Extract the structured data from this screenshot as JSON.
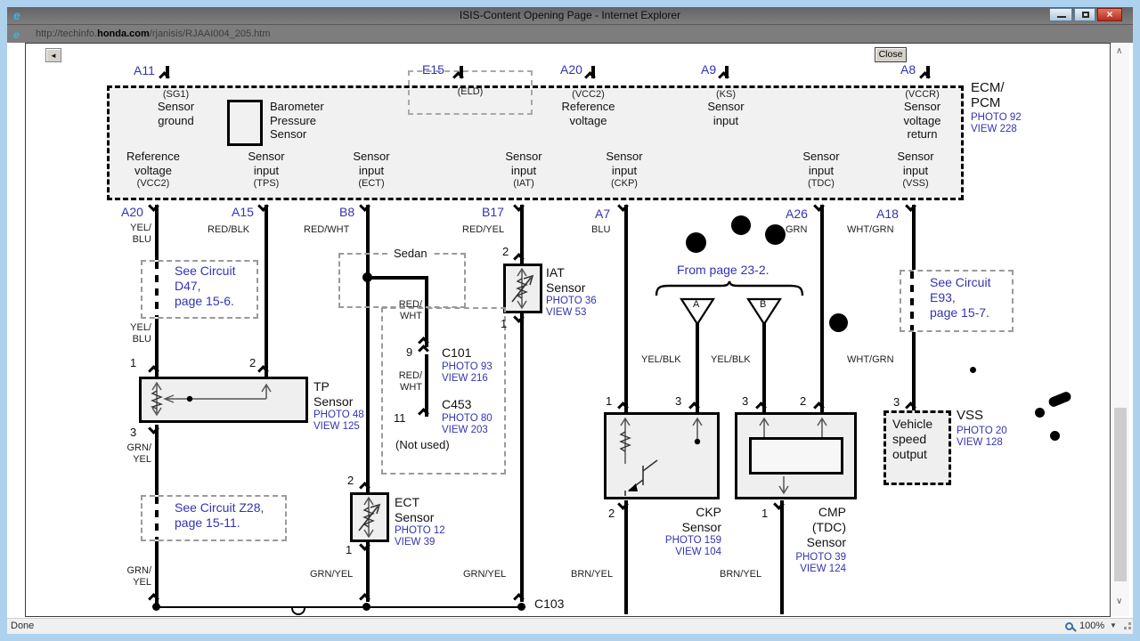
{
  "chrome": {
    "title": "ISIS-Content Opening Page - Internet Explorer",
    "url_prefix": "http://techinfo.",
    "url_domain": "honda.com",
    "url_suffix": "/rjanisis/RJAAI004_205.htm",
    "close_button": "Close",
    "status": "Done",
    "zoom_level": "100%",
    "icons": {
      "ie_logo": "e",
      "back": "◄",
      "scroll_up": "∧",
      "scroll_down": "∨",
      "zoom_dropdown": "▼",
      "window_close": "×"
    }
  },
  "colors": {
    "accent_blue": "#3333b3",
    "wire_black": "#000000",
    "box_fill": "#efefef"
  },
  "ecm": {
    "top_pins": [
      "A11",
      "E15",
      "A20",
      "A9",
      "A8"
    ],
    "sg1_tag": "(SG1)",
    "sg1_name": "Sensor\nground",
    "baro_name": "Barometer\nPressure\nSensor",
    "eld_tag": "(ELD)",
    "vcc2_tag": "(VCC2)",
    "vcc2_name": "Reference\nvoltage",
    "ks_tag": "(KS)",
    "ks_name": "Sensor\ninput",
    "vccr_tag": "(VCCR)",
    "vccr_name": "Sensor\nvoltage\nreturn",
    "row": [
      {
        "name": "Reference\nvoltage",
        "tag": "(VCC2)"
      },
      {
        "name": "Sensor\ninput",
        "tag": "(TPS)"
      },
      {
        "name": "Sensor\ninput",
        "tag": "(ECT)"
      },
      {
        "name": "Sensor\ninput",
        "tag": "(IAT)"
      },
      {
        "name": "Sensor\ninput",
        "tag": "(CKP)"
      },
      {
        "name": "Sensor\ninput",
        "tag": "(TDC)"
      },
      {
        "name": "Sensor\ninput",
        "tag": "(VSS)"
      }
    ],
    "unit_name": "ECM/\nPCM",
    "photo": "PHOTO 92",
    "view": "VIEW 228"
  },
  "pins": [
    "A20",
    "A15",
    "B8",
    "B17",
    "A7",
    "A26",
    "A18"
  ],
  "wire_labels": {
    "a20": "YEL/\nBLU",
    "a20_2": "YEL/\nBLU",
    "a15": "RED/BLK",
    "b8": "RED/WHT",
    "b17": "RED/YEL",
    "a7": "BLU",
    "a26": "GRN",
    "a18": "WHT/GRN",
    "a18_2": "WHT/GRN",
    "branch_1": "RED/\nWHT",
    "branch_2": "RED/\nWHT",
    "tp_out": "GRN/\nYEL",
    "tp_out_2": "GRN/\nYEL",
    "ect_out": "GRN/YEL",
    "iat_out": "GRN/YEL",
    "ckp_out": "BRN/YEL",
    "cmp_out": "BRN/YEL",
    "tri_a": "YEL/BLK",
    "tri_b": "YEL/BLK"
  },
  "callouts": {
    "d47": "See Circuit\nD47,\npage 15-6.",
    "z28": "See Circuit Z28,\npage 15-11.",
    "e93": "See Circuit\nE93,\npage 15-7.",
    "from_page": "From page 23-2.",
    "sedan": "Sedan",
    "not_used": "(Not used)"
  },
  "triangles": {
    "a": "A",
    "b": "B"
  },
  "sensors": {
    "tp": {
      "name": "TP\nSensor",
      "photo": "PHOTO 48",
      "view": "VIEW 125",
      "pin1": "1",
      "pin2": "2",
      "pin3": "3"
    },
    "ect": {
      "name": "ECT\nSensor",
      "photo": "PHOTO 12",
      "view": "VIEW 39",
      "pin_top": "2",
      "pin_bottom": "1"
    },
    "iat": {
      "name": "IAT\nSensor",
      "photo": "PHOTO 36",
      "view": "VIEW 53",
      "pin_top": "2",
      "pin_bottom": "1"
    },
    "ckp": {
      "name": "CKP\nSensor",
      "photo": "PHOTO 159",
      "view": "VIEW 104",
      "pin1": "1",
      "pin3": "3",
      "pin_bottom": "2"
    },
    "cmp": {
      "name": "CMP\n(TDC)\nSensor",
      "photo": "PHOTO 39",
      "view": "VIEW 124",
      "pin3": "3",
      "pin2": "2",
      "pin_bottom": "1"
    },
    "vss": {
      "name": "VSS",
      "photo": "PHOTO 20",
      "view": "VIEW 128",
      "box_label": "Vehicle\nspeed\noutput",
      "pin": "3"
    }
  },
  "connectors": {
    "c101": {
      "pin": "9",
      "name": "C101",
      "photo": "PHOTO 93",
      "view": "VIEW 216"
    },
    "c453": {
      "pin": "11",
      "name": "C453",
      "photo": "PHOTO 80",
      "view": "VIEW 203"
    },
    "c103": "C103"
  }
}
